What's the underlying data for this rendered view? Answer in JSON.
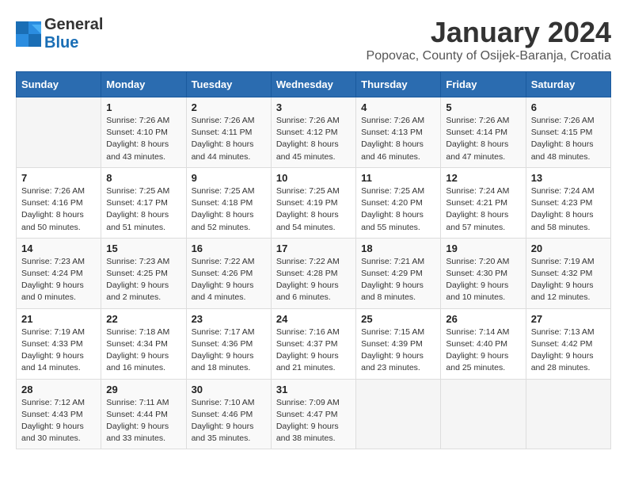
{
  "header": {
    "logo_general": "General",
    "logo_blue": "Blue",
    "month_title": "January 2024",
    "location": "Popovac, County of Osijek-Baranja, Croatia"
  },
  "weekdays": [
    "Sunday",
    "Monday",
    "Tuesday",
    "Wednesday",
    "Thursday",
    "Friday",
    "Saturday"
  ],
  "weeks": [
    [
      {
        "day": "",
        "info": ""
      },
      {
        "day": "1",
        "info": "Sunrise: 7:26 AM\nSunset: 4:10 PM\nDaylight: 8 hours\nand 43 minutes."
      },
      {
        "day": "2",
        "info": "Sunrise: 7:26 AM\nSunset: 4:11 PM\nDaylight: 8 hours\nand 44 minutes."
      },
      {
        "day": "3",
        "info": "Sunrise: 7:26 AM\nSunset: 4:12 PM\nDaylight: 8 hours\nand 45 minutes."
      },
      {
        "day": "4",
        "info": "Sunrise: 7:26 AM\nSunset: 4:13 PM\nDaylight: 8 hours\nand 46 minutes."
      },
      {
        "day": "5",
        "info": "Sunrise: 7:26 AM\nSunset: 4:14 PM\nDaylight: 8 hours\nand 47 minutes."
      },
      {
        "day": "6",
        "info": "Sunrise: 7:26 AM\nSunset: 4:15 PM\nDaylight: 8 hours\nand 48 minutes."
      }
    ],
    [
      {
        "day": "7",
        "info": "Sunrise: 7:26 AM\nSunset: 4:16 PM\nDaylight: 8 hours\nand 50 minutes."
      },
      {
        "day": "8",
        "info": "Sunrise: 7:25 AM\nSunset: 4:17 PM\nDaylight: 8 hours\nand 51 minutes."
      },
      {
        "day": "9",
        "info": "Sunrise: 7:25 AM\nSunset: 4:18 PM\nDaylight: 8 hours\nand 52 minutes."
      },
      {
        "day": "10",
        "info": "Sunrise: 7:25 AM\nSunset: 4:19 PM\nDaylight: 8 hours\nand 54 minutes."
      },
      {
        "day": "11",
        "info": "Sunrise: 7:25 AM\nSunset: 4:20 PM\nDaylight: 8 hours\nand 55 minutes."
      },
      {
        "day": "12",
        "info": "Sunrise: 7:24 AM\nSunset: 4:21 PM\nDaylight: 8 hours\nand 57 minutes."
      },
      {
        "day": "13",
        "info": "Sunrise: 7:24 AM\nSunset: 4:23 PM\nDaylight: 8 hours\nand 58 minutes."
      }
    ],
    [
      {
        "day": "14",
        "info": "Sunrise: 7:23 AM\nSunset: 4:24 PM\nDaylight: 9 hours\nand 0 minutes."
      },
      {
        "day": "15",
        "info": "Sunrise: 7:23 AM\nSunset: 4:25 PM\nDaylight: 9 hours\nand 2 minutes."
      },
      {
        "day": "16",
        "info": "Sunrise: 7:22 AM\nSunset: 4:26 PM\nDaylight: 9 hours\nand 4 minutes."
      },
      {
        "day": "17",
        "info": "Sunrise: 7:22 AM\nSunset: 4:28 PM\nDaylight: 9 hours\nand 6 minutes."
      },
      {
        "day": "18",
        "info": "Sunrise: 7:21 AM\nSunset: 4:29 PM\nDaylight: 9 hours\nand 8 minutes."
      },
      {
        "day": "19",
        "info": "Sunrise: 7:20 AM\nSunset: 4:30 PM\nDaylight: 9 hours\nand 10 minutes."
      },
      {
        "day": "20",
        "info": "Sunrise: 7:19 AM\nSunset: 4:32 PM\nDaylight: 9 hours\nand 12 minutes."
      }
    ],
    [
      {
        "day": "21",
        "info": "Sunrise: 7:19 AM\nSunset: 4:33 PM\nDaylight: 9 hours\nand 14 minutes."
      },
      {
        "day": "22",
        "info": "Sunrise: 7:18 AM\nSunset: 4:34 PM\nDaylight: 9 hours\nand 16 minutes."
      },
      {
        "day": "23",
        "info": "Sunrise: 7:17 AM\nSunset: 4:36 PM\nDaylight: 9 hours\nand 18 minutes."
      },
      {
        "day": "24",
        "info": "Sunrise: 7:16 AM\nSunset: 4:37 PM\nDaylight: 9 hours\nand 21 minutes."
      },
      {
        "day": "25",
        "info": "Sunrise: 7:15 AM\nSunset: 4:39 PM\nDaylight: 9 hours\nand 23 minutes."
      },
      {
        "day": "26",
        "info": "Sunrise: 7:14 AM\nSunset: 4:40 PM\nDaylight: 9 hours\nand 25 minutes."
      },
      {
        "day": "27",
        "info": "Sunrise: 7:13 AM\nSunset: 4:42 PM\nDaylight: 9 hours\nand 28 minutes."
      }
    ],
    [
      {
        "day": "28",
        "info": "Sunrise: 7:12 AM\nSunset: 4:43 PM\nDaylight: 9 hours\nand 30 minutes."
      },
      {
        "day": "29",
        "info": "Sunrise: 7:11 AM\nSunset: 4:44 PM\nDaylight: 9 hours\nand 33 minutes."
      },
      {
        "day": "30",
        "info": "Sunrise: 7:10 AM\nSunset: 4:46 PM\nDaylight: 9 hours\nand 35 minutes."
      },
      {
        "day": "31",
        "info": "Sunrise: 7:09 AM\nSunset: 4:47 PM\nDaylight: 9 hours\nand 38 minutes."
      },
      {
        "day": "",
        "info": ""
      },
      {
        "day": "",
        "info": ""
      },
      {
        "day": "",
        "info": ""
      }
    ]
  ]
}
